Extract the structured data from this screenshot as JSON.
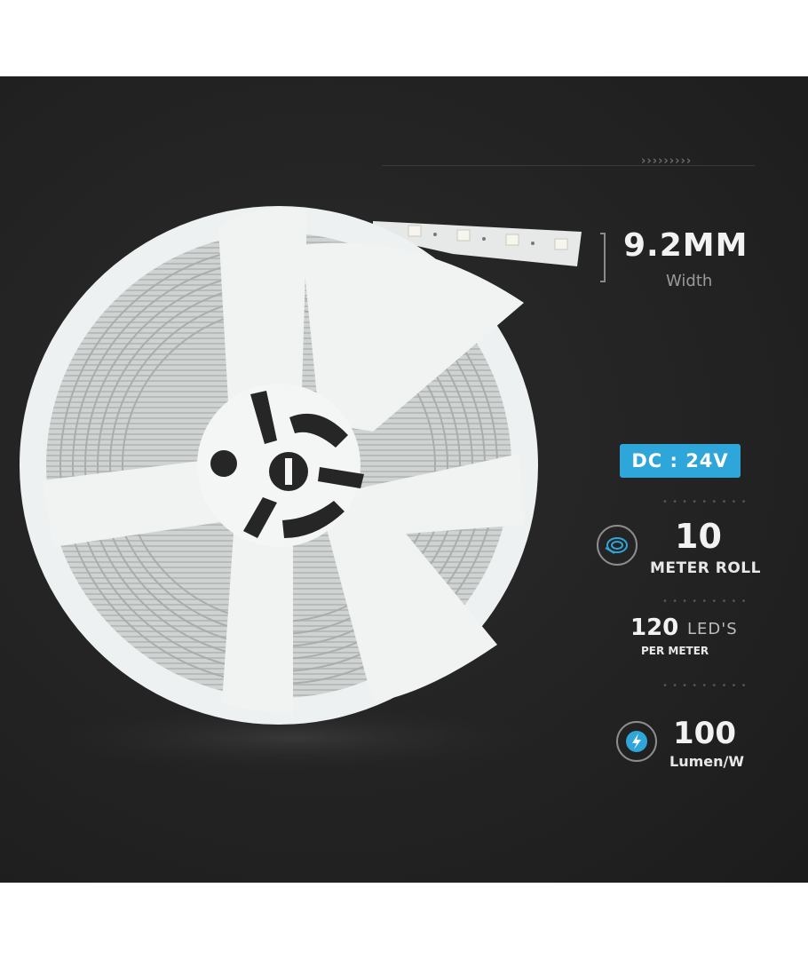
{
  "specs": {
    "chevrons": "›››››››››",
    "width": {
      "value": "9.2MM",
      "label": "Width"
    },
    "voltage": {
      "label": "DC : 24V"
    },
    "roll": {
      "number": "10",
      "label": "METER ROLL",
      "icon": "reel-icon"
    },
    "leds": {
      "number": "120",
      "unit": "LED'S",
      "label": "PER METER"
    },
    "efficiency": {
      "number": "100",
      "label": "Lumen/W",
      "icon": "lightning-icon"
    }
  },
  "colors": {
    "background": "#232323",
    "accent": "#2fa6d9",
    "reel": "#f1f3f3",
    "text": "#f2f2f2"
  }
}
